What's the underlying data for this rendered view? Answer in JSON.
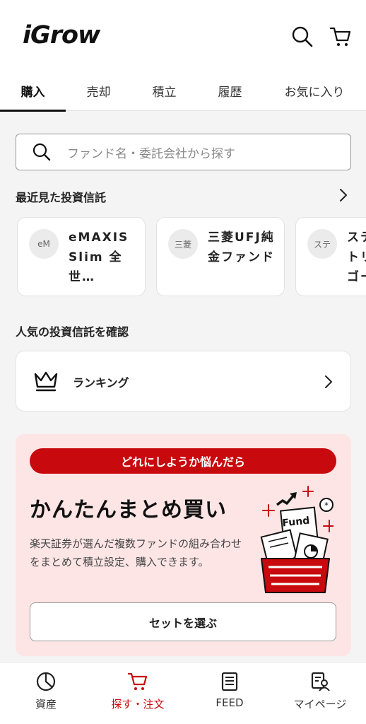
{
  "header": {
    "logo": "iGrow",
    "icons": [
      "search-icon",
      "cart-icon"
    ]
  },
  "tabs": [
    {
      "label": "購入",
      "active": true
    },
    {
      "label": "売却",
      "active": false
    },
    {
      "label": "積立",
      "active": false
    },
    {
      "label": "履歴",
      "active": false
    },
    {
      "label": "お気に入り",
      "active": false
    }
  ],
  "search": {
    "placeholder": "ファンド名・委託会社から探す"
  },
  "recent": {
    "title": "最近見た投資信託",
    "funds": [
      {
        "avatar": "eM",
        "name": "eMAXIS Slim 全世…"
      },
      {
        "avatar": "三菱",
        "name": "三菱UFJ純金ファンド"
      },
      {
        "avatar": "ステ",
        "name": "ステトリゴー"
      }
    ]
  },
  "popular": {
    "title": "人気の投資信託を確認",
    "ranking_label": "ランキング"
  },
  "promo": {
    "badge": "どれにしようか悩んだら",
    "title": "かんたんまとめ買い",
    "description": "楽天証券が選んだ複数ファンドの組み合わせをまとめて積立設定、購入できます。",
    "illustration_text": "Fund",
    "button_label": "セットを選ぶ",
    "accent_color": "#c8090d",
    "background_color": "#fde5e5"
  },
  "bottom_nav": [
    {
      "label": "資産",
      "icon": "pie-chart-icon",
      "active": false
    },
    {
      "label": "探す・注文",
      "icon": "cart-icon",
      "active": true
    },
    {
      "label": "FEED",
      "icon": "news-icon",
      "active": false
    },
    {
      "label": "マイページ",
      "icon": "profile-icon",
      "active": false
    }
  ]
}
